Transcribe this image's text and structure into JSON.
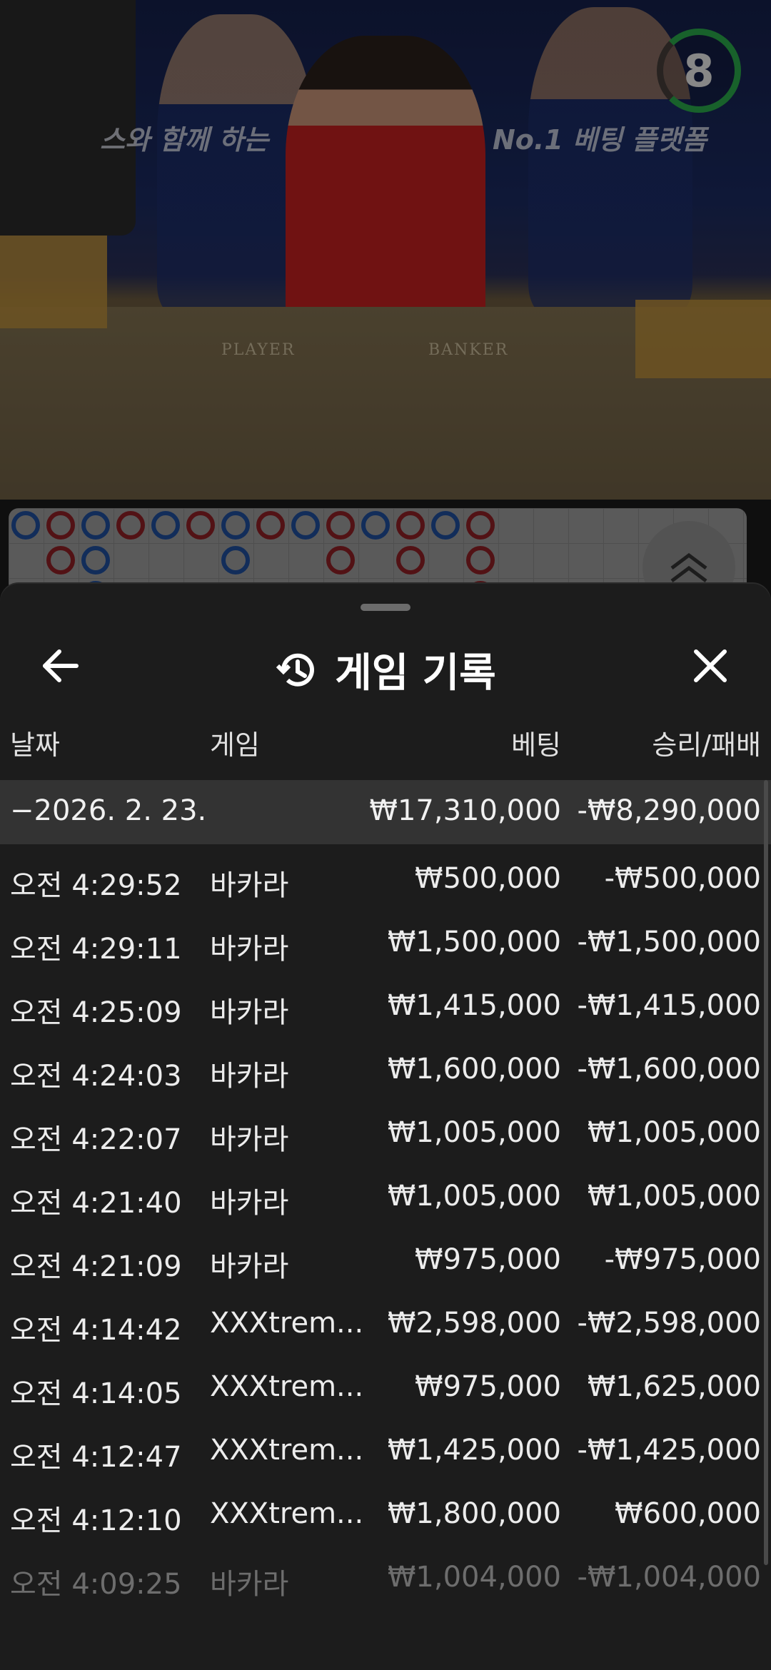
{
  "video": {
    "banner_left": "스와 함께 하는",
    "banner_right": "No.1 베팅 플랫폼",
    "table_player": "PLAYER",
    "table_banker": "BANKER",
    "countdown": "8"
  },
  "colors": {
    "player": "#1f4f9c",
    "banker": "#8e1f25",
    "timer_ring": "#2aa84a"
  },
  "roadmap": {
    "columns": [
      [
        "p"
      ],
      [
        "b",
        "b"
      ],
      [
        "p",
        "p",
        "p"
      ],
      [
        "b"
      ],
      [
        "p"
      ],
      [
        "b"
      ],
      [
        "p",
        "p"
      ],
      [
        "b"
      ],
      [
        "p"
      ],
      [
        "b",
        "b"
      ],
      [
        "p"
      ],
      [
        "b",
        "b"
      ],
      [
        "p"
      ],
      [
        "b",
        "b",
        "b"
      ]
    ]
  },
  "sheet": {
    "title": "게임 기록",
    "icons": {
      "back": "arrow-left-icon",
      "history": "history-icon",
      "close": "close-icon",
      "expand": "chevron-double-up-icon"
    },
    "headers": {
      "date": "날짜",
      "game": "게임",
      "bet": "베팅",
      "result": "승리/패배"
    },
    "group": {
      "date": "−2026. 2. 23.",
      "bet": "₩17,310,000",
      "result": "-₩8,290,000"
    },
    "rows": [
      {
        "time": "오전 4:29:52",
        "game": "바카라",
        "bet": "₩500,000",
        "result": "-₩500,000"
      },
      {
        "time": "오전 4:29:11",
        "game": "바카라",
        "bet": "₩1,500,000",
        "result": "-₩1,500,000"
      },
      {
        "time": "오전 4:25:09",
        "game": "바카라",
        "bet": "₩1,415,000",
        "result": "-₩1,415,000"
      },
      {
        "time": "오전 4:24:03",
        "game": "바카라",
        "bet": "₩1,600,000",
        "result": "-₩1,600,000"
      },
      {
        "time": "오전 4:22:07",
        "game": "바카라",
        "bet": "₩1,005,000",
        "result": "₩1,005,000"
      },
      {
        "time": "오전 4:21:40",
        "game": "바카라",
        "bet": "₩1,005,000",
        "result": "₩1,005,000"
      },
      {
        "time": "오전 4:21:09",
        "game": "바카라",
        "bet": "₩975,000",
        "result": "-₩975,000"
      },
      {
        "time": "오전 4:14:42",
        "game": "XXXtrem...",
        "bet": "₩2,598,000",
        "result": "-₩2,598,000"
      },
      {
        "time": "오전 4:14:05",
        "game": "XXXtrem...",
        "bet": "₩975,000",
        "result": "₩1,625,000"
      },
      {
        "time": "오전 4:12:47",
        "game": "XXXtrem...",
        "bet": "₩1,425,000",
        "result": "-₩1,425,000"
      },
      {
        "time": "오전 4:12:10",
        "game": "XXXtrem...",
        "bet": "₩1,800,000",
        "result": "₩600,000"
      },
      {
        "time": "오전 4:09:25",
        "game": "바카라",
        "bet": "₩1,004,000",
        "result": "-₩1,004,000"
      }
    ]
  }
}
